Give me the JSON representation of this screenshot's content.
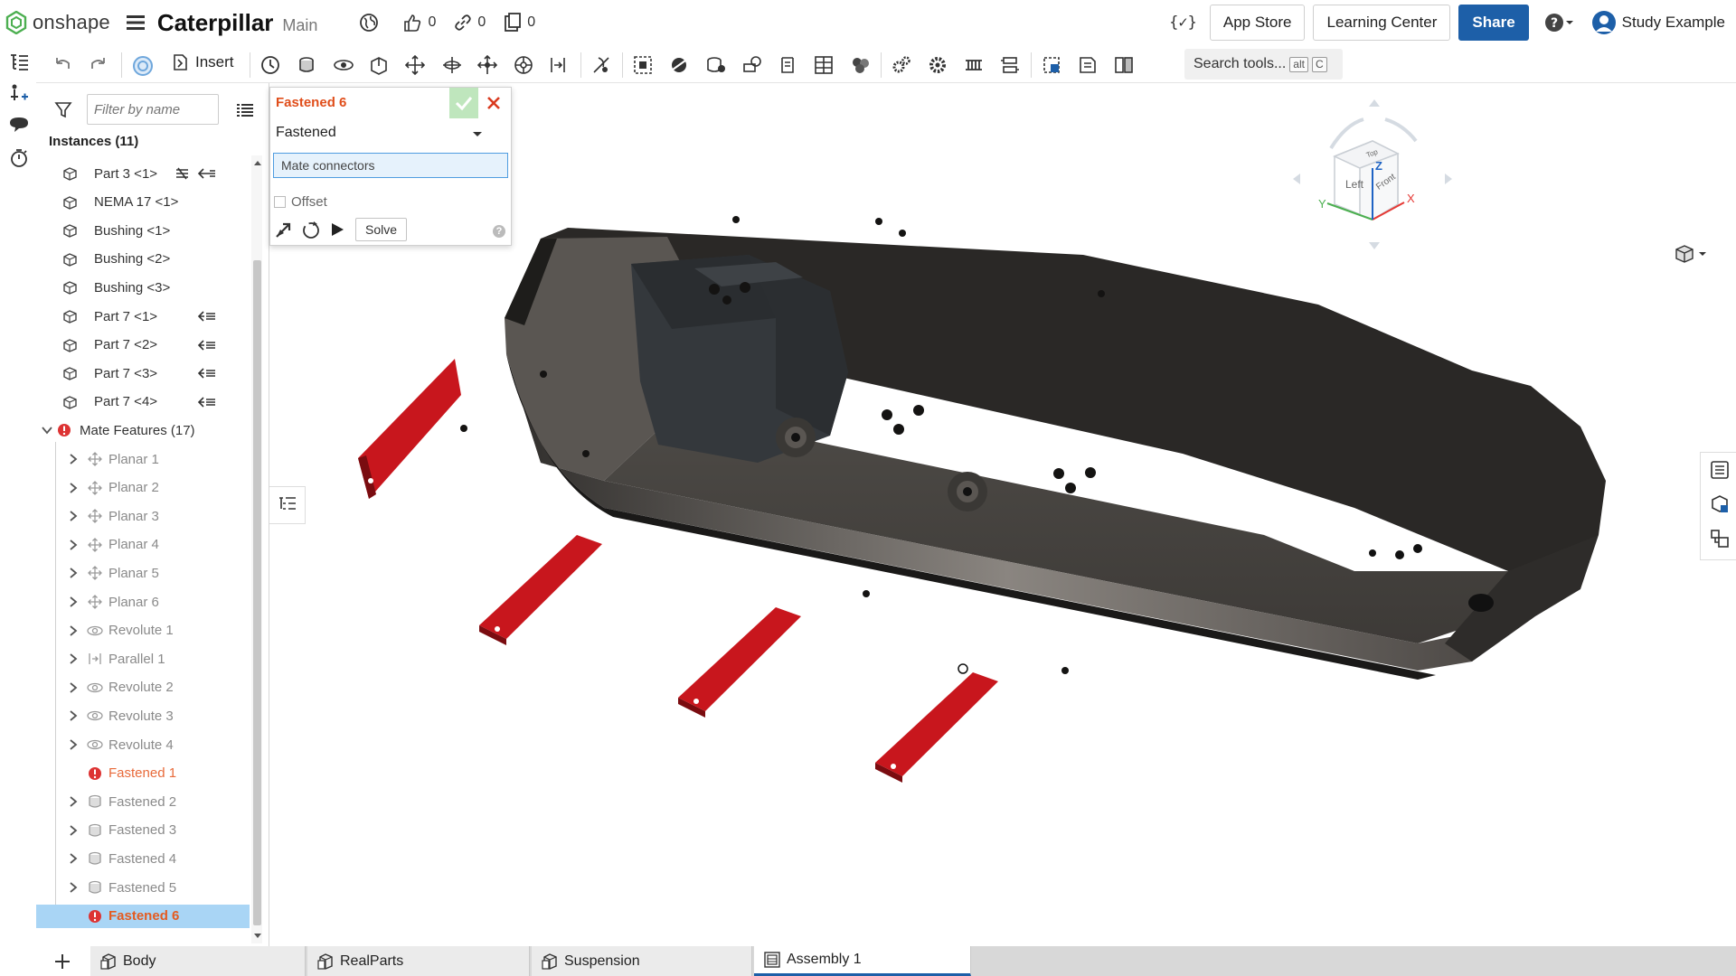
{
  "header": {
    "app_name": "onshape",
    "doc_title": "Caterpillar",
    "branch": "Main",
    "likes": "0",
    "links": "0",
    "copies": "0",
    "variables_icon": "{✓}",
    "app_store": "App Store",
    "learning_center": "Learning Center",
    "share": "Share",
    "user": "Study Example",
    "help": "?"
  },
  "toolbar": {
    "insert": "Insert",
    "search_placeholder": "Search tools...",
    "shortcut_mod": "alt",
    "shortcut_key": "C"
  },
  "panel": {
    "filter_placeholder": "Filter by name",
    "instances_title": "Instances (11)",
    "instances": [
      {
        "label": "Part 3 <1>",
        "suffix": "hatch"
      },
      {
        "label": "NEMA 17 <1>",
        "suffix": ""
      },
      {
        "label": "Bushing <1>",
        "suffix": ""
      },
      {
        "label": "Bushing <2>",
        "suffix": ""
      },
      {
        "label": "Bushing <3>",
        "suffix": ""
      },
      {
        "label": "Part 7 <1>",
        "suffix": "arrow"
      },
      {
        "label": "Part 7 <2>",
        "suffix": "arrow"
      },
      {
        "label": "Part 7 <3>",
        "suffix": "arrow"
      },
      {
        "label": "Part 7 <4>",
        "suffix": "arrow"
      }
    ],
    "mate_group": "Mate Features (17)",
    "mates": [
      {
        "label": "Planar 1",
        "type": "planar"
      },
      {
        "label": "Planar 2",
        "type": "planar"
      },
      {
        "label": "Planar 3",
        "type": "planar"
      },
      {
        "label": "Planar 4",
        "type": "planar"
      },
      {
        "label": "Planar 5",
        "type": "planar"
      },
      {
        "label": "Planar 6",
        "type": "planar"
      },
      {
        "label": "Revolute 1",
        "type": "revolute"
      },
      {
        "label": "Parallel 1",
        "type": "parallel"
      },
      {
        "label": "Revolute 2",
        "type": "revolute"
      },
      {
        "label": "Revolute 3",
        "type": "revolute"
      },
      {
        "label": "Revolute 4",
        "type": "revolute"
      },
      {
        "label": "Fastened 1",
        "type": "error"
      },
      {
        "label": "Fastened 2",
        "type": "fastened"
      },
      {
        "label": "Fastened 3",
        "type": "fastened"
      },
      {
        "label": "Fastened 4",
        "type": "fastened"
      },
      {
        "label": "Fastened 5",
        "type": "fastened"
      },
      {
        "label": "Fastened 6",
        "type": "error-selected"
      }
    ]
  },
  "dialog": {
    "title": "Fastened 6",
    "mate_type": "Fastened",
    "field_label": "Mate connectors",
    "offset_label": "Offset",
    "solve": "Solve",
    "help": "?"
  },
  "viewcube": {
    "left": "Left",
    "front": "Front",
    "top": "Top",
    "axis_x": "X",
    "axis_y": "Y",
    "axis_z": "Z"
  },
  "tabs": [
    {
      "label": "Body",
      "type": "partstudio"
    },
    {
      "label": "RealParts",
      "type": "partstudio"
    },
    {
      "label": "Suspension",
      "type": "partstudio"
    },
    {
      "label": "Assembly 1",
      "type": "assembly",
      "active": true
    }
  ],
  "colors": {
    "accent": "#1d5fa8",
    "feature_title": "#e04e1b",
    "selection": "#a9d5f5",
    "body": "#2d2b29",
    "legs": "#c8161d"
  }
}
